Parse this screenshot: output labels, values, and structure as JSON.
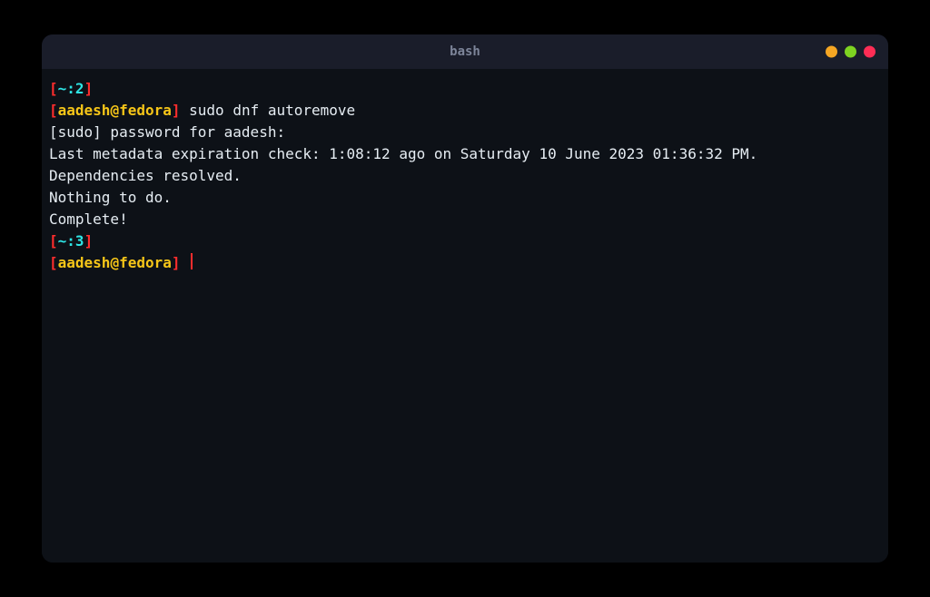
{
  "titlebar": {
    "title": "bash"
  },
  "prompt1": {
    "open_bracket": "[",
    "tilde": "~",
    "colon": ":",
    "num": "2",
    "close_bracket": "]",
    "open_bracket2": "[",
    "user": "aadesh",
    "at": "@",
    "host": "fedora",
    "close_bracket2": "]",
    "command": " sudo dnf autoremove"
  },
  "output": {
    "line1": "[sudo] password for aadesh: ",
    "line2": "Last metadata expiration check: 1:08:12 ago on Saturday 10 June 2023 01:36:32 PM.",
    "line3": "Dependencies resolved.",
    "line4": "Nothing to do.",
    "line5": "Complete!"
  },
  "prompt2": {
    "open_bracket": "[",
    "tilde": "~",
    "colon": ":",
    "num": "3",
    "close_bracket": "]",
    "open_bracket2": "[",
    "user": "aadesh",
    "at": "@",
    "host": "fedora",
    "close_bracket2": "]"
  }
}
